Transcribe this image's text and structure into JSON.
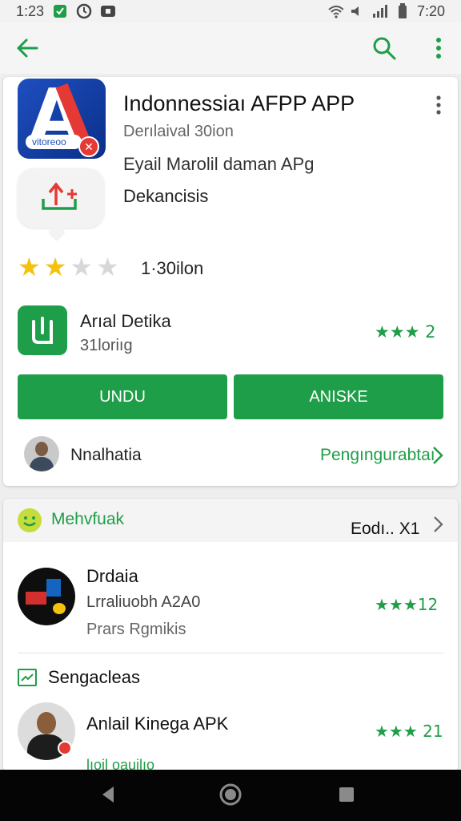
{
  "status_bar": {
    "time": "1:23",
    "clock_right": "7:20"
  },
  "app_bar": {
    "back": "back-arrow-icon",
    "search": "search-icon",
    "more": "more-vert-icon"
  },
  "app": {
    "title": "Indonnessiaı AFPP APP",
    "subtitle": "Derılaival 30ion",
    "description": "Eyail Marolil daman APg",
    "category": "Dekancisis",
    "icon_band_text": "vitoreoo"
  },
  "rating": {
    "stars_filled": 2,
    "stars_total": 5,
    "reviews": "1·30ilon"
  },
  "developer": {
    "name": "Arıal Detika",
    "sub": "31loriıg",
    "rating": "★★★ 2"
  },
  "buttons": {
    "install": "UNDU",
    "other": "ANISKE"
  },
  "user": {
    "name": "Nnalhatia",
    "reviews_link": "Pengıngurabtaı"
  },
  "section": {
    "title": "Mehvfuak",
    "more": "Eodı.. X1",
    "items": [
      {
        "name": "Drdaia",
        "sub": "Lrraliuobh A2A0",
        "meta": "Prars Rgmikis",
        "rating": "★★★12"
      },
      {
        "name": "Anlail Kinega APK",
        "rating": "★★★ 21"
      }
    ],
    "subheading": "Sengacleas",
    "peek": "lıoil oauilıo"
  },
  "colors": {
    "accent": "#1e9e48",
    "star": "#f4c20d",
    "nav": "#050505"
  }
}
